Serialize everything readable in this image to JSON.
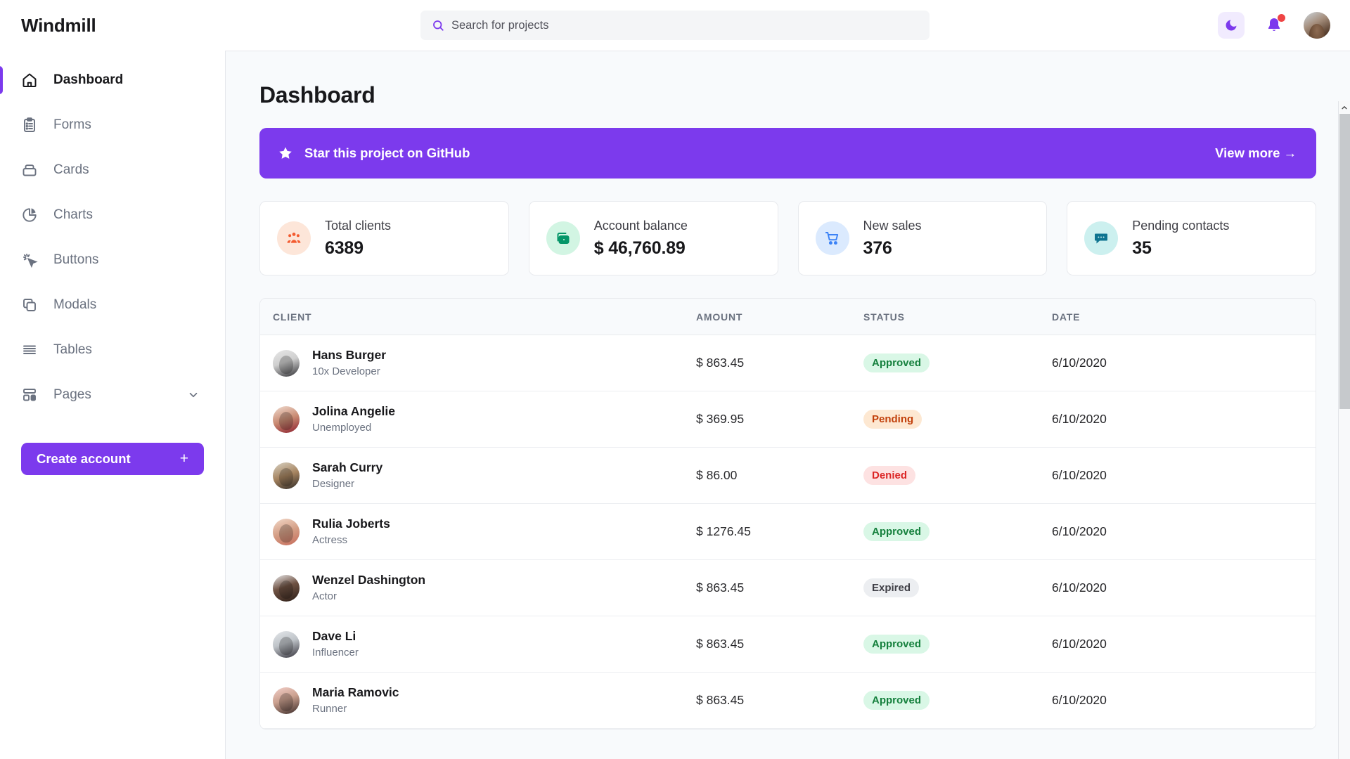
{
  "app": {
    "brand": "Windmill"
  },
  "search": {
    "placeholder": "Search for projects",
    "value": "",
    "icon": "search-icon"
  },
  "topbar": {
    "theme_toggle_icon": "moon-icon",
    "notifications_icon": "bell-icon",
    "avatar_label": "user-avatar"
  },
  "sidebar": {
    "items": [
      {
        "label": "Dashboard",
        "icon": "home-icon",
        "active": true
      },
      {
        "label": "Forms",
        "icon": "clipboard-icon",
        "active": false
      },
      {
        "label": "Cards",
        "icon": "box-icon",
        "active": false
      },
      {
        "label": "Charts",
        "icon": "pie-chart-icon",
        "active": false
      },
      {
        "label": "Buttons",
        "icon": "cursor-click-icon",
        "active": false
      },
      {
        "label": "Modals",
        "icon": "copy-icon",
        "active": false
      },
      {
        "label": "Tables",
        "icon": "list-icon",
        "active": false
      },
      {
        "label": "Pages",
        "icon": "layout-icon",
        "active": false,
        "expandable": true
      }
    ],
    "create_button": {
      "label": "Create account",
      "plus": "+"
    }
  },
  "main": {
    "page_title": "Dashboard",
    "promo": {
      "text": "Star this project on GitHub",
      "cta": "View more →",
      "icon": "star-icon",
      "color": "#7c3aed"
    },
    "stats": [
      {
        "label": "Total clients",
        "value": "6389",
        "icon": "people-group-icon",
        "icon_color": "#f35b30",
        "bg": "#fde6d9"
      },
      {
        "label": "Account balance",
        "value": "$ 46,760.89",
        "icon": "money-icon",
        "icon_color": "#059669",
        "bg": "#d2f5e3"
      },
      {
        "label": "New sales",
        "value": "376",
        "icon": "cart-icon",
        "icon_color": "#3b82f6",
        "bg": "#dbeafe"
      },
      {
        "label": "Pending contacts",
        "value": "35",
        "icon": "chat-icon",
        "icon_color": "#0e7490",
        "bg": "#ccf0ef"
      }
    ],
    "table": {
      "columns": [
        "CLIENT",
        "AMOUNT",
        "STATUS",
        "DATE"
      ],
      "rows": [
        {
          "name": "Hans Burger",
          "role": "10x Developer",
          "amount": "$ 863.45",
          "status": "Approved",
          "status_kind": "approved",
          "date": "6/10/2020"
        },
        {
          "name": "Jolina Angelie",
          "role": "Unemployed",
          "amount": "$ 369.95",
          "status": "Pending",
          "status_kind": "pending",
          "date": "6/10/2020"
        },
        {
          "name": "Sarah Curry",
          "role": "Designer",
          "amount": "$ 86.00",
          "status": "Denied",
          "status_kind": "denied",
          "date": "6/10/2020"
        },
        {
          "name": "Rulia Joberts",
          "role": "Actress",
          "amount": "$ 1276.45",
          "status": "Approved",
          "status_kind": "approved",
          "date": "6/10/2020"
        },
        {
          "name": "Wenzel Dashington",
          "role": "Actor",
          "amount": "$ 863.45",
          "status": "Expired",
          "status_kind": "expired",
          "date": "6/10/2020"
        },
        {
          "name": "Dave Li",
          "role": "Influencer",
          "amount": "$ 863.45",
          "status": "Approved",
          "status_kind": "approved",
          "date": "6/10/2020"
        },
        {
          "name": "Maria Ramovic",
          "role": "Runner",
          "amount": "$ 863.45",
          "status": "Approved",
          "status_kind": "approved",
          "date": "6/10/2020"
        }
      ]
    }
  },
  "colors": {
    "accent": "#7c3aed",
    "page_bg": "#f8fafc",
    "approved": "#15803d",
    "pending": "#c2410c",
    "denied": "#dc2626",
    "expired": "#3f3f46",
    "notification_dot": "#ef4444"
  }
}
